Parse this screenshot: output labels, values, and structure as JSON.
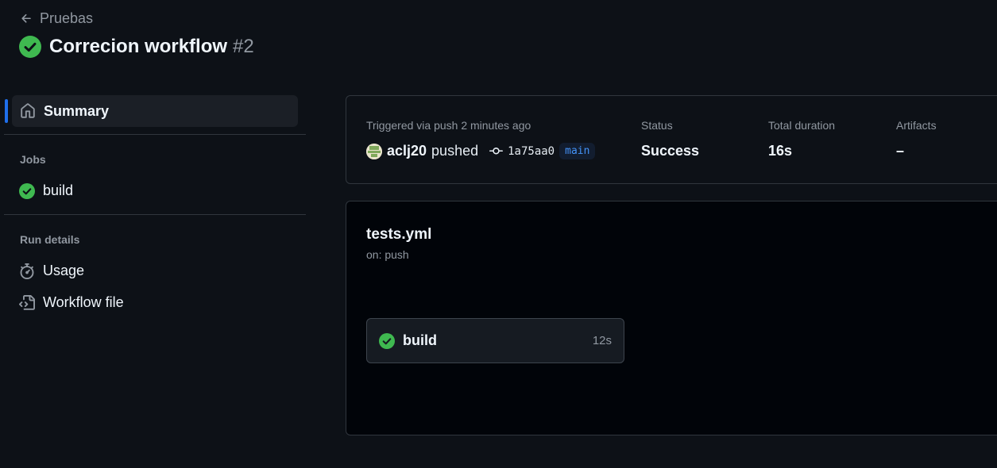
{
  "header": {
    "back_label": "Pruebas",
    "title": "Correcion workflow",
    "run_number": "#2",
    "status_color": "#3fb950"
  },
  "sidebar": {
    "summary_label": "Summary",
    "jobs_heading": "Jobs",
    "jobs": [
      {
        "label": "build",
        "status": "success"
      }
    ],
    "run_details_heading": "Run details",
    "run_details": [
      {
        "label": "Usage",
        "icon": "stopwatch-icon"
      },
      {
        "label": "Workflow file",
        "icon": "file-code-icon"
      }
    ]
  },
  "summary": {
    "trigger_label": "Triggered via push 2 minutes ago",
    "actor": "aclj20",
    "action": "pushed",
    "commit_sha": "1a75aa0",
    "branch": "main",
    "status_label": "Status",
    "status_value": "Success",
    "duration_label": "Total duration",
    "duration_value": "16s",
    "artifacts_label": "Artifacts",
    "artifacts_value": "–"
  },
  "graph": {
    "workflow_file": "tests.yml",
    "trigger": "on: push",
    "job": {
      "name": "build",
      "duration": "12s"
    }
  },
  "colors": {
    "background": "#0d1117",
    "accent": "#1f6feb",
    "success": "#3fb950",
    "branch_text": "#4493f8"
  }
}
